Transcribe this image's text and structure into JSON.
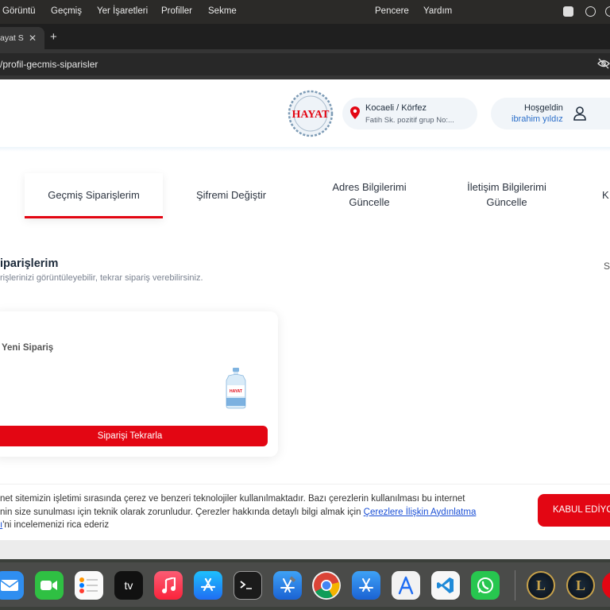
{
  "menubar": {
    "items": [
      "Görüntü",
      "Geçmiş",
      "Yer İşaretleri",
      "Profiller",
      "Sekme",
      "Pencere",
      "Yardım"
    ]
  },
  "browser": {
    "tab_title": "ayat S",
    "tab_close": "✕",
    "new_tab": "+",
    "url": "/profil-gecmis-siparisler"
  },
  "header": {
    "logo_text": "HAYAT",
    "location_city": "Kocaeli / Körfez",
    "location_address": "Fatih Sk. pozitif grup No:...",
    "greeting": "Hoşgeldin",
    "user_name": "ibrahim yıldız",
    "accent_color": "#e30613"
  },
  "tabs": [
    {
      "label": "Geçmiş Siparişlerim",
      "active": true
    },
    {
      "label": "Şifremi Değiştir",
      "active": false
    },
    {
      "label": "Adres Bilgilerimi Güncelle",
      "active": false
    },
    {
      "label": "İletişim Bilgilerimi Güncelle",
      "active": false
    },
    {
      "label": "K",
      "active": false
    }
  ],
  "section": {
    "title": "iparişlerim",
    "subtitle": "rişlerinizi görüntüleyebilir, tekrar sipariş verebilirsiniz.",
    "right_label": "S"
  },
  "order_card": {
    "status": "Yeni Sipariş",
    "product_icon": "water-bottle-icon",
    "reorder_label": "Siparişi Tekrarla"
  },
  "cookie": {
    "text_line1": "net sitemizin işletimi sırasında çerez ve benzeri teknolojiler kullanılmaktadır. Bazı çerezlerin kullanılması bu internet",
    "text_line2_before": "nin size sunulması için teknik olarak zorunludur. Çerezler hakkında detaylı bilgi almak için ",
    "link_text": "Çerezlere İlişkin Aydınlatma",
    "text_line3_link": "ı",
    "text_line3_after": "'ni incelemenizi rica ederiz",
    "accept_label": "KABUL EDİYO"
  },
  "dock": {
    "apps": [
      "mail-icon",
      "facetime-icon",
      "reminders-icon",
      "apple-tv-icon",
      "music-icon",
      "app-store-icon",
      "terminal-icon",
      "xcode-icon",
      "chrome-icon",
      "instruments-icon",
      "simulator-icon",
      "vscode-icon",
      "whatsapp-icon",
      "league-client-icon",
      "league-of-legends-icon",
      "app-icon"
    ],
    "tv_label": "tv"
  }
}
